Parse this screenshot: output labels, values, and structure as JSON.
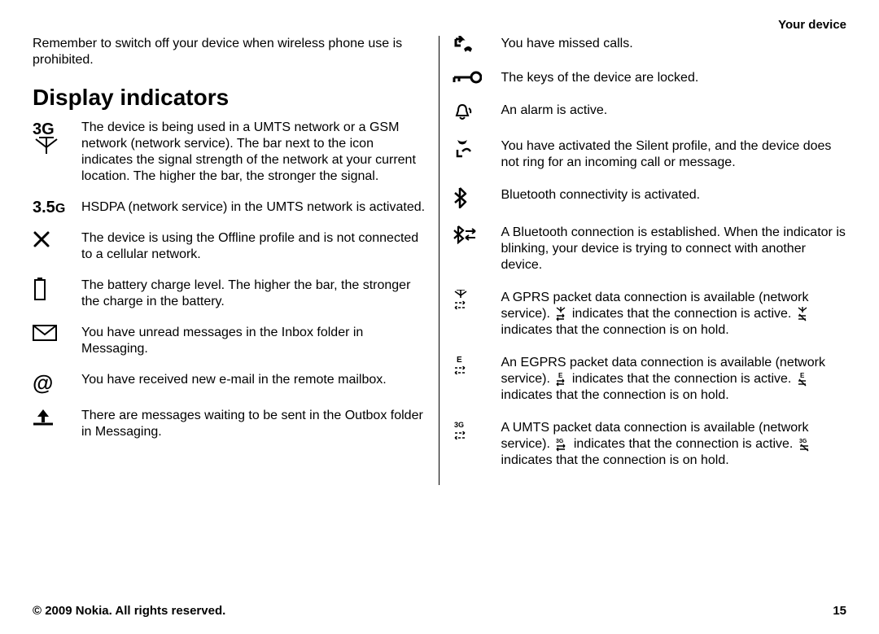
{
  "header": {
    "section": "Your device"
  },
  "intro": "Remember to switch off your device when wireless phone use is prohibited.",
  "title": "Display indicators",
  "left": [
    {
      "icon": "3g-signal",
      "text": "The device is being used in a UMTS network or a GSM network (network service). The bar next to the icon indicates the signal strength of the network at your current location. The higher the bar, the stronger the signal."
    },
    {
      "icon": "3.5g-label",
      "text": "HSDPA (network service) in the UMTS network is activated."
    },
    {
      "icon": "offline-x",
      "text": "The device is using the Offline profile and is not connected to a cellular network."
    },
    {
      "icon": "battery",
      "text": "The battery charge level. The higher the bar, the stronger the charge in the battery."
    },
    {
      "icon": "envelope",
      "text": "You have unread messages in the Inbox folder in Messaging."
    },
    {
      "icon": "at-sign",
      "text": "You have received new e-mail in the remote mailbox."
    },
    {
      "icon": "outbox",
      "text": "There are messages waiting to be sent in the Outbox folder in Messaging."
    }
  ],
  "right": [
    {
      "icon": "missed-call",
      "text": "You have missed calls."
    },
    {
      "icon": "key-lock",
      "text": "The keys of the device are locked."
    },
    {
      "icon": "alarm-bell",
      "text": "An alarm is active."
    },
    {
      "icon": "silent-profile",
      "text": "You have activated the Silent profile, and the device does not ring for an incoming call or message."
    },
    {
      "icon": "bluetooth",
      "text": "Bluetooth connectivity is activated."
    },
    {
      "icon": "bluetooth-connected",
      "text": "A Bluetooth connection is established. When the indicator is blinking, your device is trying to connect with another device."
    },
    {
      "icon": "gprs",
      "pre": "A GPRS packet data connection is available (network service). ",
      "mid": " indicates that the connection is active. ",
      "post": " indicates that the connection is on hold."
    },
    {
      "icon": "egprs",
      "pre": "An EGPRS packet data connection is available (network service). ",
      "mid": " indicates that the connection is active. ",
      "post": " indicates that the connection is on hold."
    },
    {
      "icon": "umts-data",
      "pre": "A UMTS packet data connection is available (network service). ",
      "mid": " indicates that the connection is active. ",
      "post": " indicates that the connection is on hold."
    }
  ],
  "footer": {
    "copyright": "© 2009 Nokia. All rights reserved.",
    "page": "15"
  }
}
